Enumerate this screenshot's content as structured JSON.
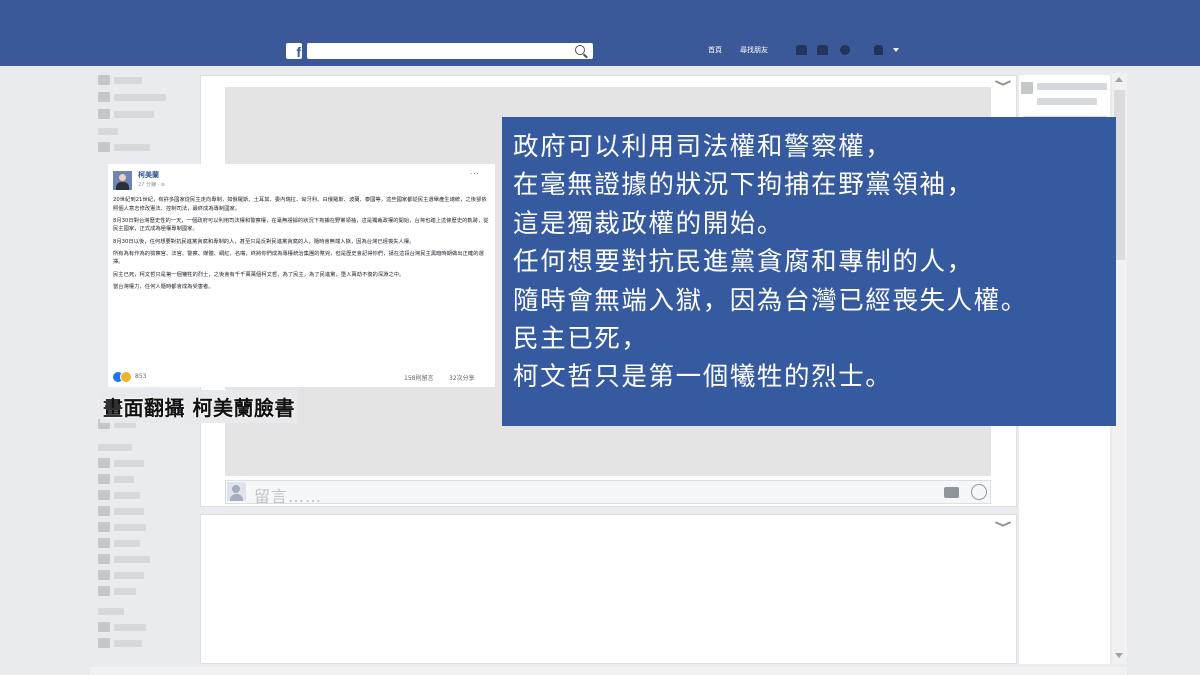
{
  "header": {
    "logo": "f",
    "nav": [
      "首頁",
      "尋找朋友"
    ],
    "user_menu": "▾",
    "colors": {
      "bar": "#3b5998"
    }
  },
  "comment_box": {
    "placeholder": "留言……"
  },
  "inset_post": {
    "author": "柯美蘭",
    "time": "27 分鐘 · ⊚",
    "more": "···",
    "paragraphs": [
      "20世紀到21世紀，有許多國家從民主走向專制，如俄羅斯、土耳其、委內瑞拉、匈牙利、白俄羅斯、波蘭、泰國等，這些國家都從民主選舉產生總統，之後卻依照個人意志修改憲法、控制司法，最終成為專制國家。",
      "8月30日對台灣歷史性的一天，一個政府可以利用司法權和警察權，在毫無證據的狀況下拘捕在野黨領袖，這是獨裁政權的開始，台灣也踏上這條歷史的軌跡，從民主國家，正式成為極權專制國家。",
      "8月30日以後，任何想要對抗民進黨貪腐和專制的人，甚至只是反對民進黨貪腐的人，隨時會無端入獄，因為台灣已經喪失人權。",
      "所有為有作為的檢察官、法官、警察、媒體、網紅、名嘴，終將你們成為專權統治集團的幫兇，但是歷史會記得你們，請在這段台灣民主黑暗時期做出正確的選擇。",
      "民主已死，柯文哲只是第一個犧牲的烈士，之後會有千千萬萬個柯文哲，為了民主，為了民進黨，墮入萬劫不復的深淵之中。",
      "當台灣權力，任何人隨時都會成為受害者。"
    ],
    "reactions": "853",
    "comments": "158則留言",
    "shares": "32次分享"
  },
  "caption": "畫面翻攝 柯美蘭臉書",
  "quote": {
    "lines": [
      "政府可以利用司法權和警察權，",
      "在毫無證據的狀況下拘捕在野黨領袖，",
      "這是獨裁政權的開始。",
      "任何想要對抗民進黨貪腐和專制的人，",
      "隨時會無端入獄，因為台灣已經喪失人權。",
      "民主已死，",
      "柯文哲只是第一個犧牲的烈士。"
    ],
    "colors": {
      "background": "#365a9f",
      "text": "#ffffff"
    }
  }
}
